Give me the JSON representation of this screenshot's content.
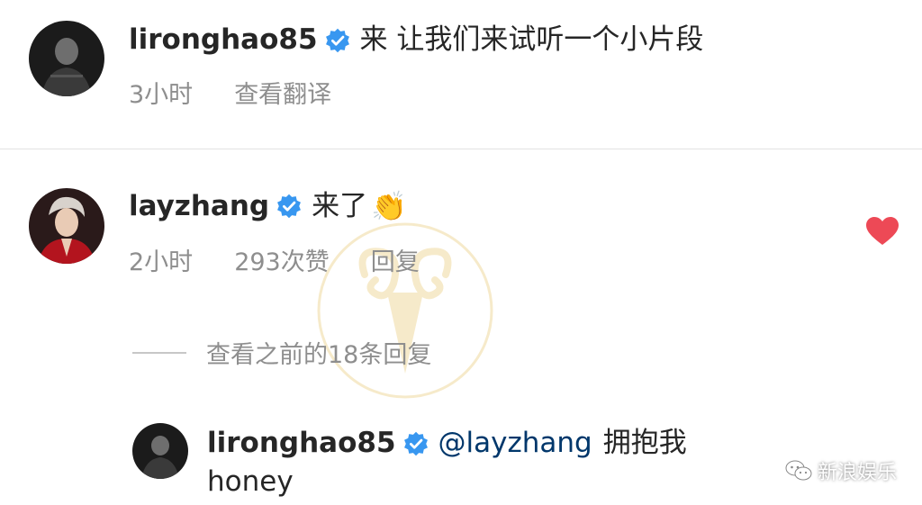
{
  "comments": [
    {
      "username": "lironghao85",
      "text": "来 让我们来试听一个小片段",
      "time": "3小时",
      "translate": "查看翻译"
    },
    {
      "username": "layzhang",
      "text": "来了",
      "emoji": "👏",
      "time": "2小时",
      "likes": "293次赞",
      "reply": "回复",
      "liked": true
    }
  ],
  "view_previous_replies": "查看之前的18条回复",
  "reply_comment": {
    "username": "lironghao85",
    "mention": "@layzhang",
    "text": "拥抱我",
    "text_line2": "honey"
  },
  "watermark_brand": "新浪娱乐",
  "colors": {
    "verified": "#3897f0",
    "heart": "#ed4956",
    "meta": "#8e8e8e",
    "mention": "#00376b",
    "watermark": "#e8c66a"
  }
}
